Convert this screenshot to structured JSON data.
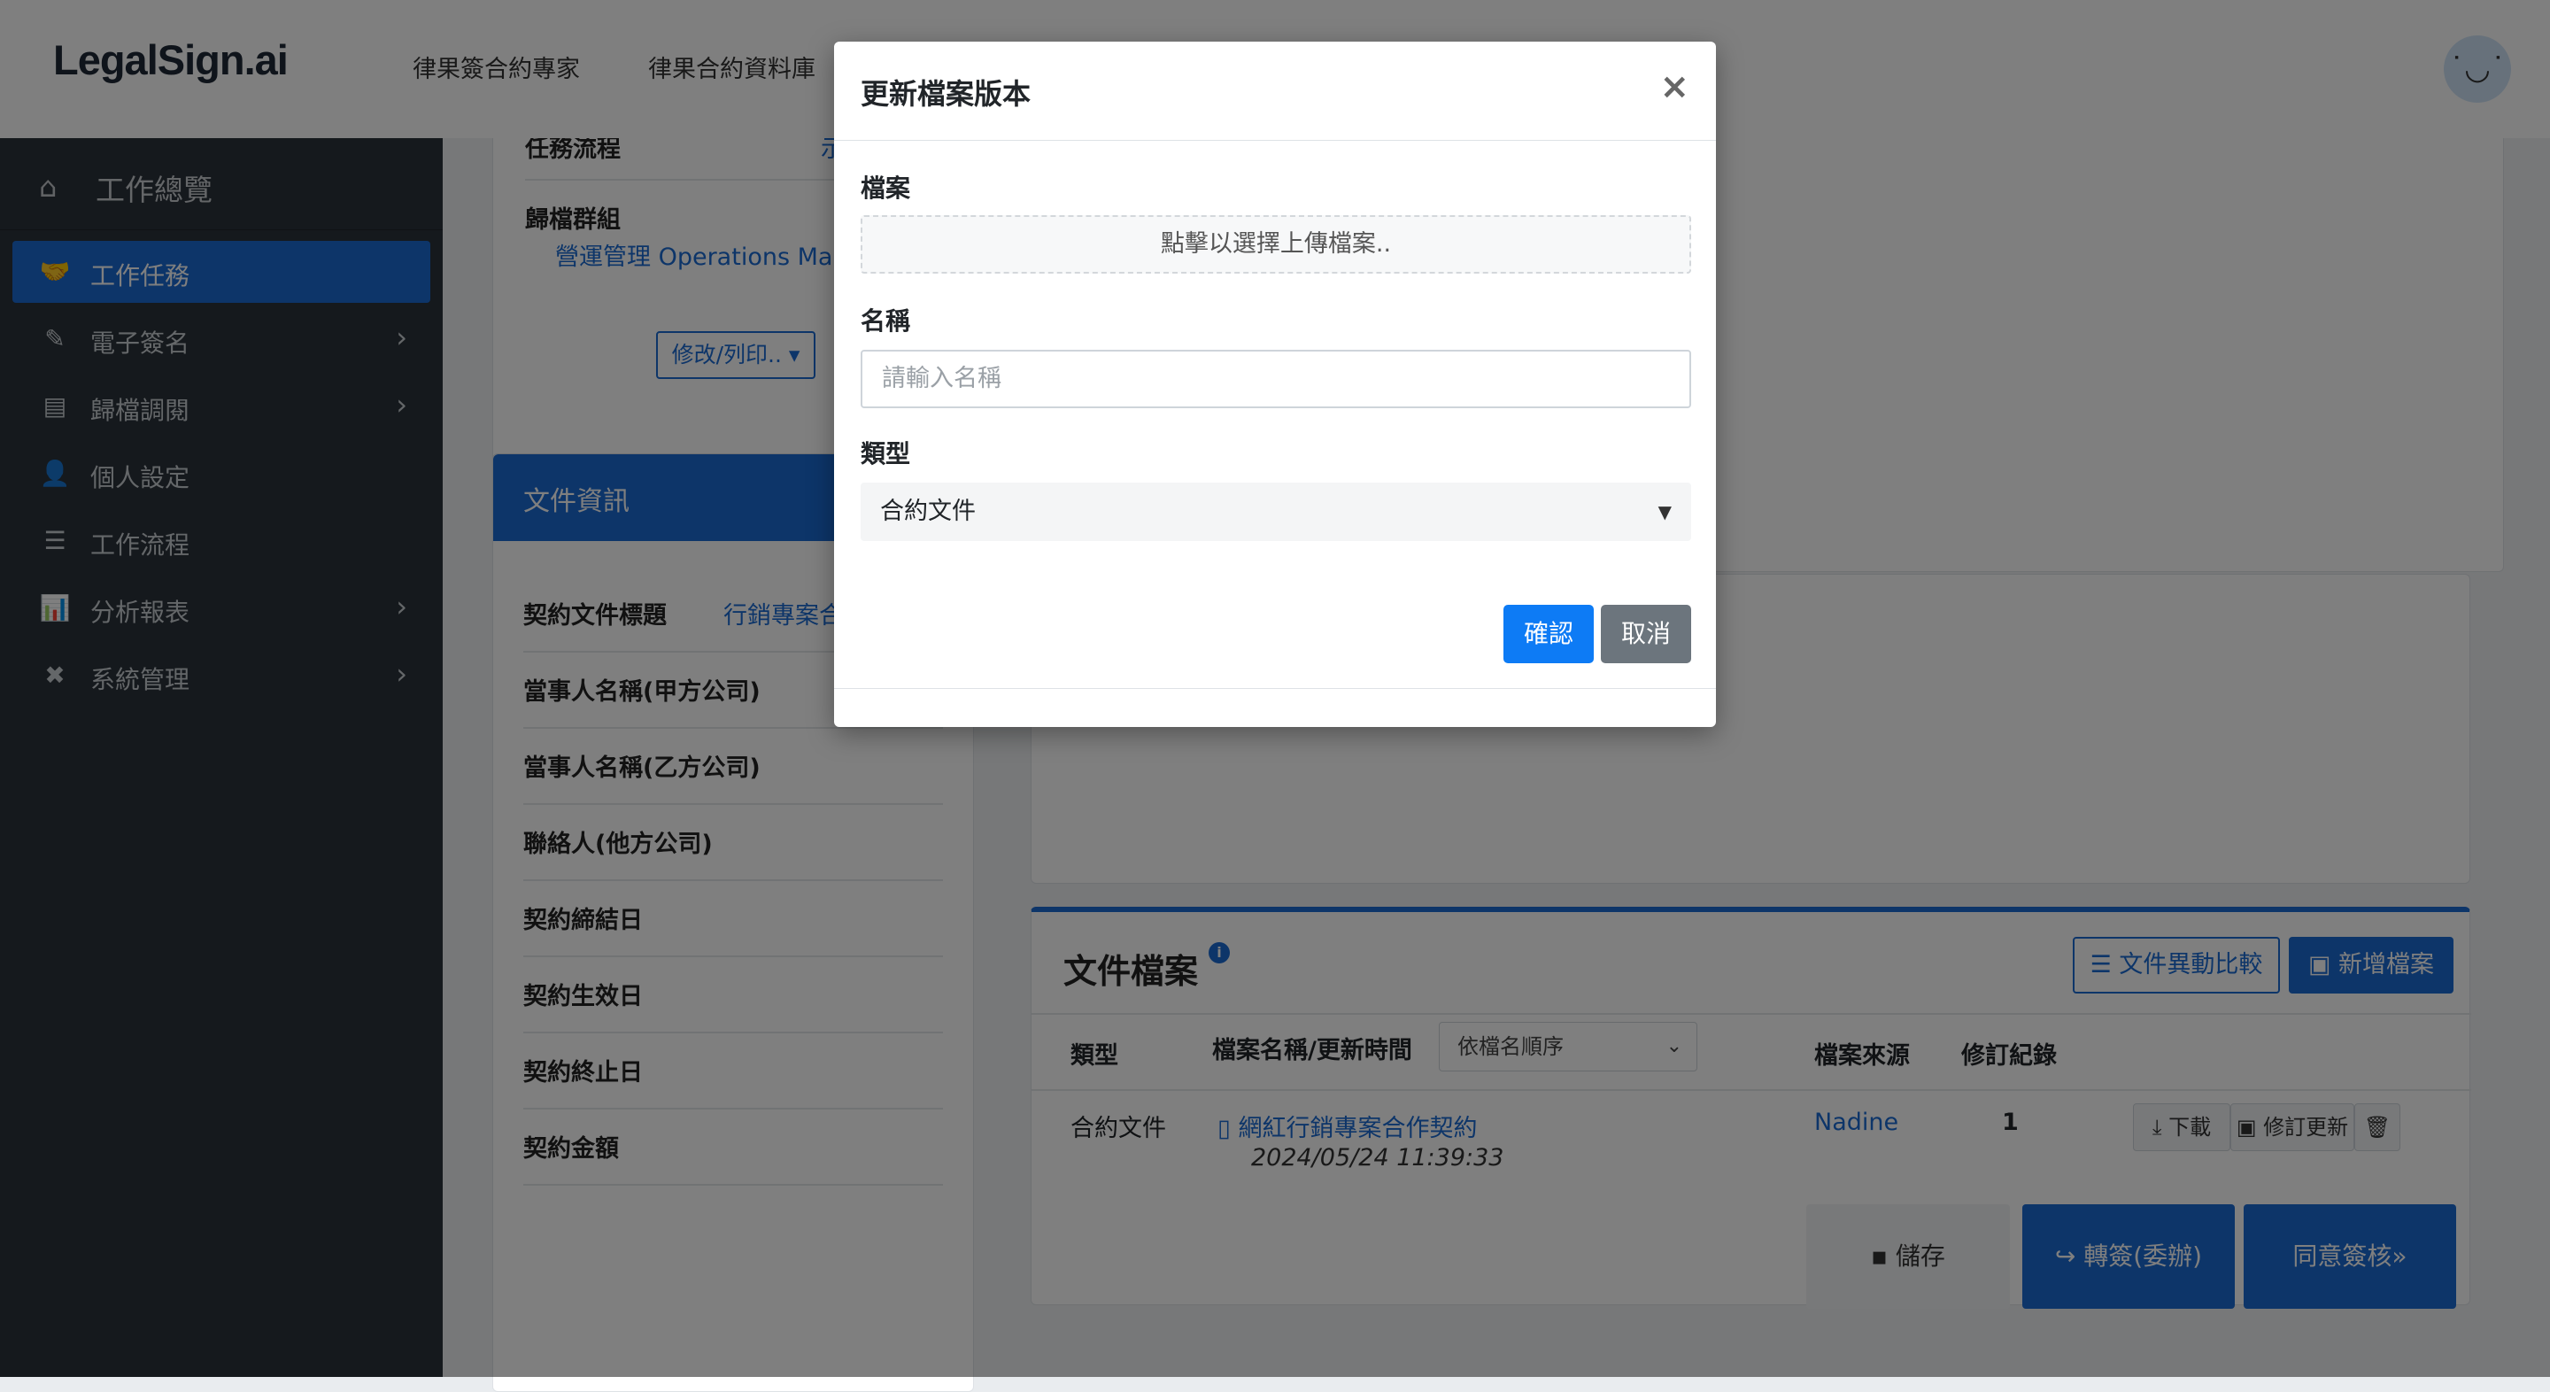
{
  "brand": {
    "logo": "LegalSign.ai"
  },
  "topnav": [
    "律果簽合約專家",
    "律果合約資料庫"
  ],
  "avatar": {
    "face": "˙◡˙"
  },
  "sidebar": {
    "overview": "工作總覽",
    "items": [
      {
        "label": "工作任務",
        "icon": "handshake-icon",
        "glyph": "🤝",
        "active": true,
        "chevron": false
      },
      {
        "label": "電子簽名",
        "icon": "signature-icon",
        "glyph": "✎",
        "active": false,
        "chevron": true
      },
      {
        "label": "歸檔調閱",
        "icon": "archive-icon",
        "glyph": "▤",
        "active": false,
        "chevron": true
      },
      {
        "label": "個人設定",
        "icon": "user-gear-icon",
        "glyph": "👤",
        "active": false,
        "chevron": false
      },
      {
        "label": "工作流程",
        "icon": "list-check-icon",
        "glyph": "☰",
        "active": false,
        "chevron": false
      },
      {
        "label": "分析報表",
        "icon": "chart-icon",
        "glyph": "📊",
        "active": false,
        "chevron": true
      },
      {
        "label": "系統管理",
        "icon": "tools-icon",
        "glyph": "✖",
        "active": false,
        "chevron": true
      }
    ],
    "chevron_glyph": "›"
  },
  "task": {
    "flow_label": "任務流程",
    "flow_value": "示",
    "group_label": "歸檔群組",
    "group_value": "營運管理 Operations Ma",
    "edit_button": "修改/列印.. ▾"
  },
  "doc_info": {
    "header": "文件資訊",
    "title_label": "契約文件標題",
    "title_value": "行銷專案合",
    "fields": [
      "當事人名稱(甲方公司)",
      "當事人名稱(乙方公司)",
      "聯絡人(他方公司)",
      "契約締結日",
      "契約生效日",
      "契約終止日",
      "契約金額"
    ]
  },
  "files": {
    "title": "文件檔案",
    "info_glyph": "i",
    "compare_button": "☰ 文件異動比較",
    "add_button": "▣ 新增檔案",
    "columns": {
      "type": "類型",
      "name": "檔案名稱/更新時間",
      "sort": "依檔名順序",
      "source": "檔案來源",
      "revisions": "修訂紀錄"
    },
    "rows": [
      {
        "type": "合約文件",
        "name": "網紅行銷專案合作契約",
        "time": "2024/05/24 11:39:33",
        "source": "Nadine",
        "revisions": "1"
      }
    ],
    "row_actions": {
      "download": "⤓ 下載",
      "revise": "▣ 修訂更新",
      "delete": "🗑"
    }
  },
  "actions": {
    "save": "▪ 儲存",
    "transfer": "↪ 轉簽(委辦)",
    "approve": "同意簽核»"
  },
  "modal": {
    "title": "更新檔案版本",
    "close": "×",
    "file_label": "檔案",
    "file_prompt": "點擊以選擇上傳檔案..",
    "name_label": "名稱",
    "name_placeholder": "請輸入名稱",
    "type_label": "類型",
    "type_value": "合約文件",
    "caret": "▼",
    "confirm": "確認",
    "cancel": "取消"
  }
}
